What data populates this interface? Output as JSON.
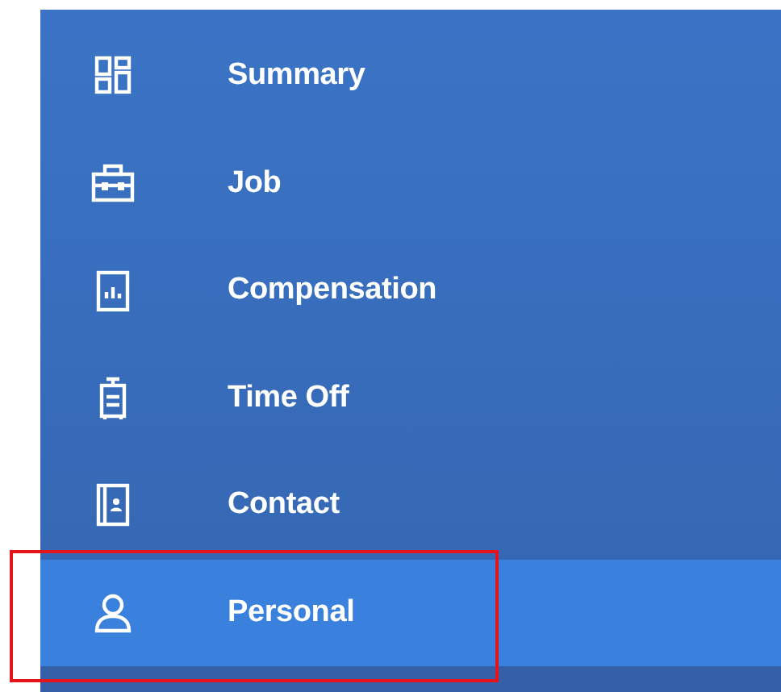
{
  "sidebar": {
    "items": [
      {
        "label": "Summary",
        "selected": false,
        "highlighted": false
      },
      {
        "label": "Job",
        "selected": false,
        "highlighted": false
      },
      {
        "label": "Compensation",
        "selected": false,
        "highlighted": false
      },
      {
        "label": "Time Off",
        "selected": false,
        "highlighted": false
      },
      {
        "label": "Contact",
        "selected": false,
        "highlighted": false
      },
      {
        "label": "Personal",
        "selected": true,
        "highlighted": true
      }
    ]
  }
}
